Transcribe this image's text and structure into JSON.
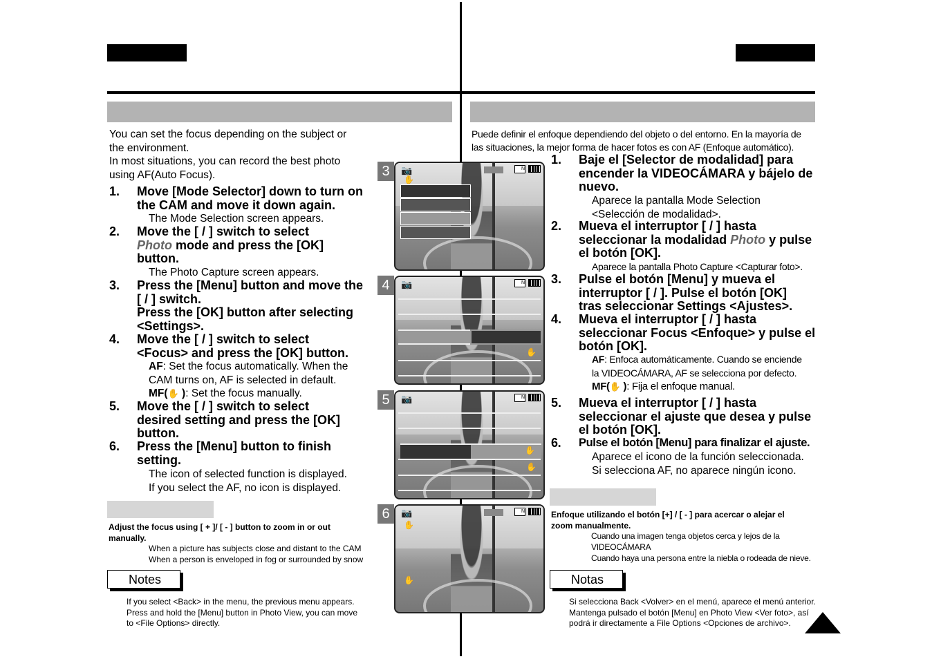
{
  "left": {
    "intro": [
      "You can set the focus depending on the subject or",
      "the environment.",
      "In most situations, you can record the best photo",
      "using AF(Auto Focus)."
    ],
    "steps": [
      {
        "num": "1.",
        "lines": [
          "Move [Mode Selector] down to turn on",
          "the CAM and move it down again."
        ],
        "sub": [
          "The Mode Selection screen appears."
        ]
      },
      {
        "num": "2.",
        "line1": "Move the [    /    ] switch to select",
        "photo": "Photo",
        "line2_rest": " mode and press the [OK]",
        "line3": "button.",
        "sub": [
          "The Photo Capture screen appears."
        ]
      },
      {
        "num": "3.",
        "lines": [
          "Press the [Menu] button and move the",
          "[    /    ] switch.",
          "Press the [OK] button after selecting",
          "<Settings>."
        ]
      },
      {
        "num": "4.",
        "lines": [
          "Move the [    /    ] switch to select",
          "<Focus> and press the [OK] button."
        ],
        "af_label": "AF",
        "af_text": ": Set the focus automatically. When the",
        "af_text2": "CAM turns on, AF is selected in default.",
        "mf_label": "MF(",
        "mf_close": " )",
        "mf_text": ": Set the focus manually."
      },
      {
        "num": "5.",
        "lines": [
          "Move the [    /    ] switch to select",
          "desired setting and press the [OK]",
          "button."
        ]
      },
      {
        "num": "6.",
        "lines": [
          "Press the [Menu] button to finish",
          "setting."
        ],
        "sub": [
          "The icon of selected function is displayed.",
          "If you select the AF, no icon is displayed."
        ]
      }
    ],
    "tip_bold": [
      "Adjust the focus using [ + ]/ [ - ] button to zoom in or out",
      "manually."
    ],
    "tip_lines": [
      "When a picture has subjects close and distant to   the CAM",
      "When a person is enveloped in fog or surrounded by snow"
    ],
    "notes_label": "Notes",
    "notes": [
      "If you select <Back> in the menu, the previous menu appears.",
      "Press and hold the [Menu] button in Photo View, you can move",
      "to <File Options> directly."
    ]
  },
  "right": {
    "intro": [
      "Puede definir el enfoque dependiendo del objeto o del entorno. En la mayoría de",
      "las situaciones, la mejor forma de hacer fotos es con AF (Enfoque automático)."
    ],
    "steps": [
      {
        "num": "1.",
        "lines": [
          "Baje el [Selector de modalidad] para",
          "encender la VIDEOCÁMARA y bájelo de",
          "nuevo."
        ],
        "sub": [
          "Aparece la pantalla Mode Selection",
          "<Selección de modalidad>."
        ]
      },
      {
        "num": "2.",
        "line1": "Mueva el interruptor [    /    ] hasta",
        "line2_pre": "seleccionar la modalidad ",
        "photo": "Photo",
        "line2_post": " y pulse",
        "line3": "el botón [OK].",
        "sub": [
          "Aparece la pantalla Photo Capture <Capturar foto>."
        ]
      },
      {
        "num": "3.",
        "lines": [
          "Pulse el botón [Menu] y mueva el",
          "interruptor [    /    ]. Pulse el botón [OK]",
          "tras seleccionar Settings <Ajustes>."
        ]
      },
      {
        "num": "4.",
        "lines": [
          "Mueva el interruptor [    /    ] hasta",
          "seleccionar Focus <Enfoque> y pulse el",
          "botón [OK]."
        ],
        "af_label": "AF",
        "af_text": ": Enfoca automáticamente. Cuando se enciende",
        "af_text2": "la VIDEOCÁMARA, AF se selecciona por defecto.",
        "mf_label": "MF(",
        "mf_close": " )",
        "mf_text": ": Fija el enfoque manual."
      },
      {
        "num": "5.",
        "lines": [
          "Mueva el interruptor [    /    ] hasta",
          "seleccionar el ajuste que desea y pulse",
          "el botón [OK]."
        ]
      },
      {
        "num": "6.",
        "lines": [
          "Pulse el botón [Menu] para finalizar el ajuste."
        ],
        "sub": [
          "Aparece el icono de la función seleccionada.",
          "Si selecciona AF, no aparece ningún icono."
        ]
      }
    ],
    "tip_bold": [
      "Enfoque utilizando el botón [+] / [ - ] para acercar o alejar el",
      "zoom manualmente."
    ],
    "tip_lines": [
      "Cuando una imagen tenga objetos cerca y lejos de la",
      "VIDEOCÁMARA",
      "Cuando haya una persona entre la niebla o rodeada de nieve."
    ],
    "notes_label": "Notas",
    "notes": [
      "Si selecciona Back <Volver> en el menú, aparece el menú anterior.",
      "Mantenga pulsado el botón [Menu] en Photo View <Ver foto>, así",
      "podrá ir directamente a File Options <Opciones de archivo>."
    ]
  },
  "screens": [
    {
      "badge": "3"
    },
    {
      "badge": "4"
    },
    {
      "badge": "5"
    },
    {
      "badge": "6"
    }
  ],
  "icons": {
    "camera": "camera-icon",
    "memory": "memory-card-icon",
    "battery": "battery-icon",
    "hand": "manual-focus-hand-icon",
    "stabilizer": "stabilizer-icon",
    "next_page": "next-page-arrow-icon"
  },
  "colors": {
    "title_bar": "#b3b3b3",
    "tip_box": "#d6d6d6",
    "badge": "#777777",
    "photo_word": "#666666"
  }
}
